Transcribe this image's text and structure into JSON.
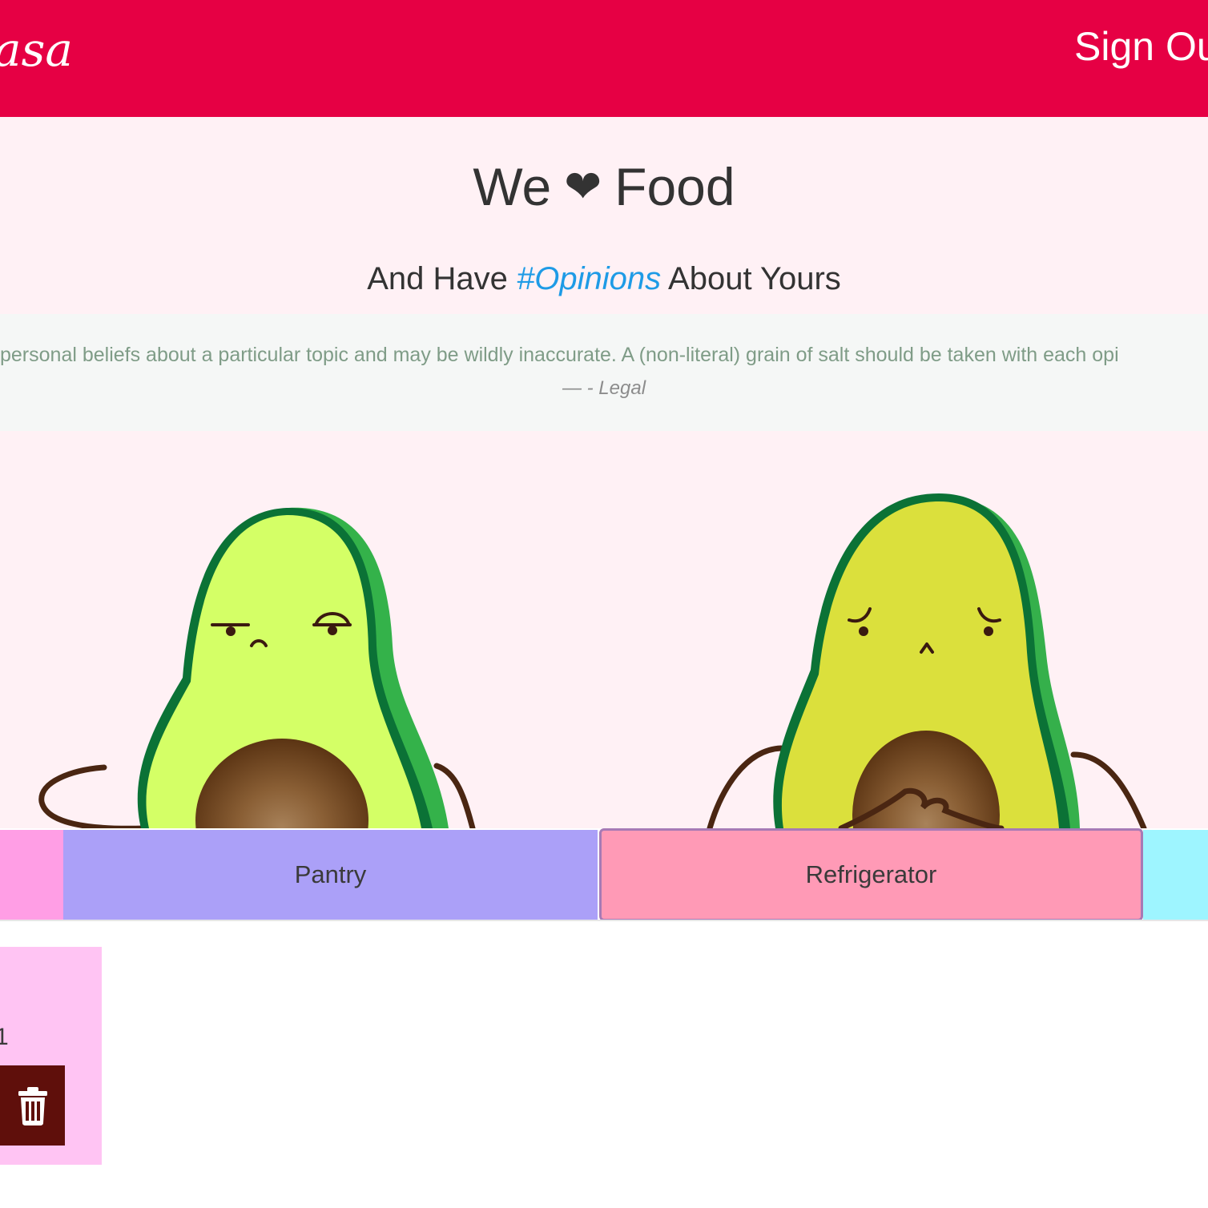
{
  "header": {
    "logo_text": "asa",
    "signout_label": "Sign Ou",
    "background_color": "#e60044"
  },
  "hero": {
    "title_left": "We",
    "title_heart": "❤",
    "title_right": "Food",
    "subtitle_prefix": "And Have ",
    "subtitle_hashtag": "#Opinions",
    "subtitle_suffix": " About Yours",
    "hashtag_color": "#1e9be6",
    "quote_text": "personal beliefs about a particular topic and may be wildly inaccurate. A (non-literal) grain of salt should be taken with each opi",
    "quote_cite": "— - Legal",
    "illustration_icons": [
      "grumpy-avocado-icon",
      "worried-avocado-icon"
    ]
  },
  "tabs": {
    "items": [
      {
        "label": "",
        "color": "#ff9ee5"
      },
      {
        "label": "Pantry",
        "color": "#aba0f8"
      },
      {
        "label": "Refrigerator",
        "color": "#ff9ab6",
        "active": true
      },
      {
        "label": "",
        "color": "#9ef5ff"
      }
    ]
  },
  "card": {
    "count_text": "1",
    "delete_icon": "trash-icon",
    "background_color": "#ffc4f3",
    "delete_color": "#5f0f0b"
  }
}
